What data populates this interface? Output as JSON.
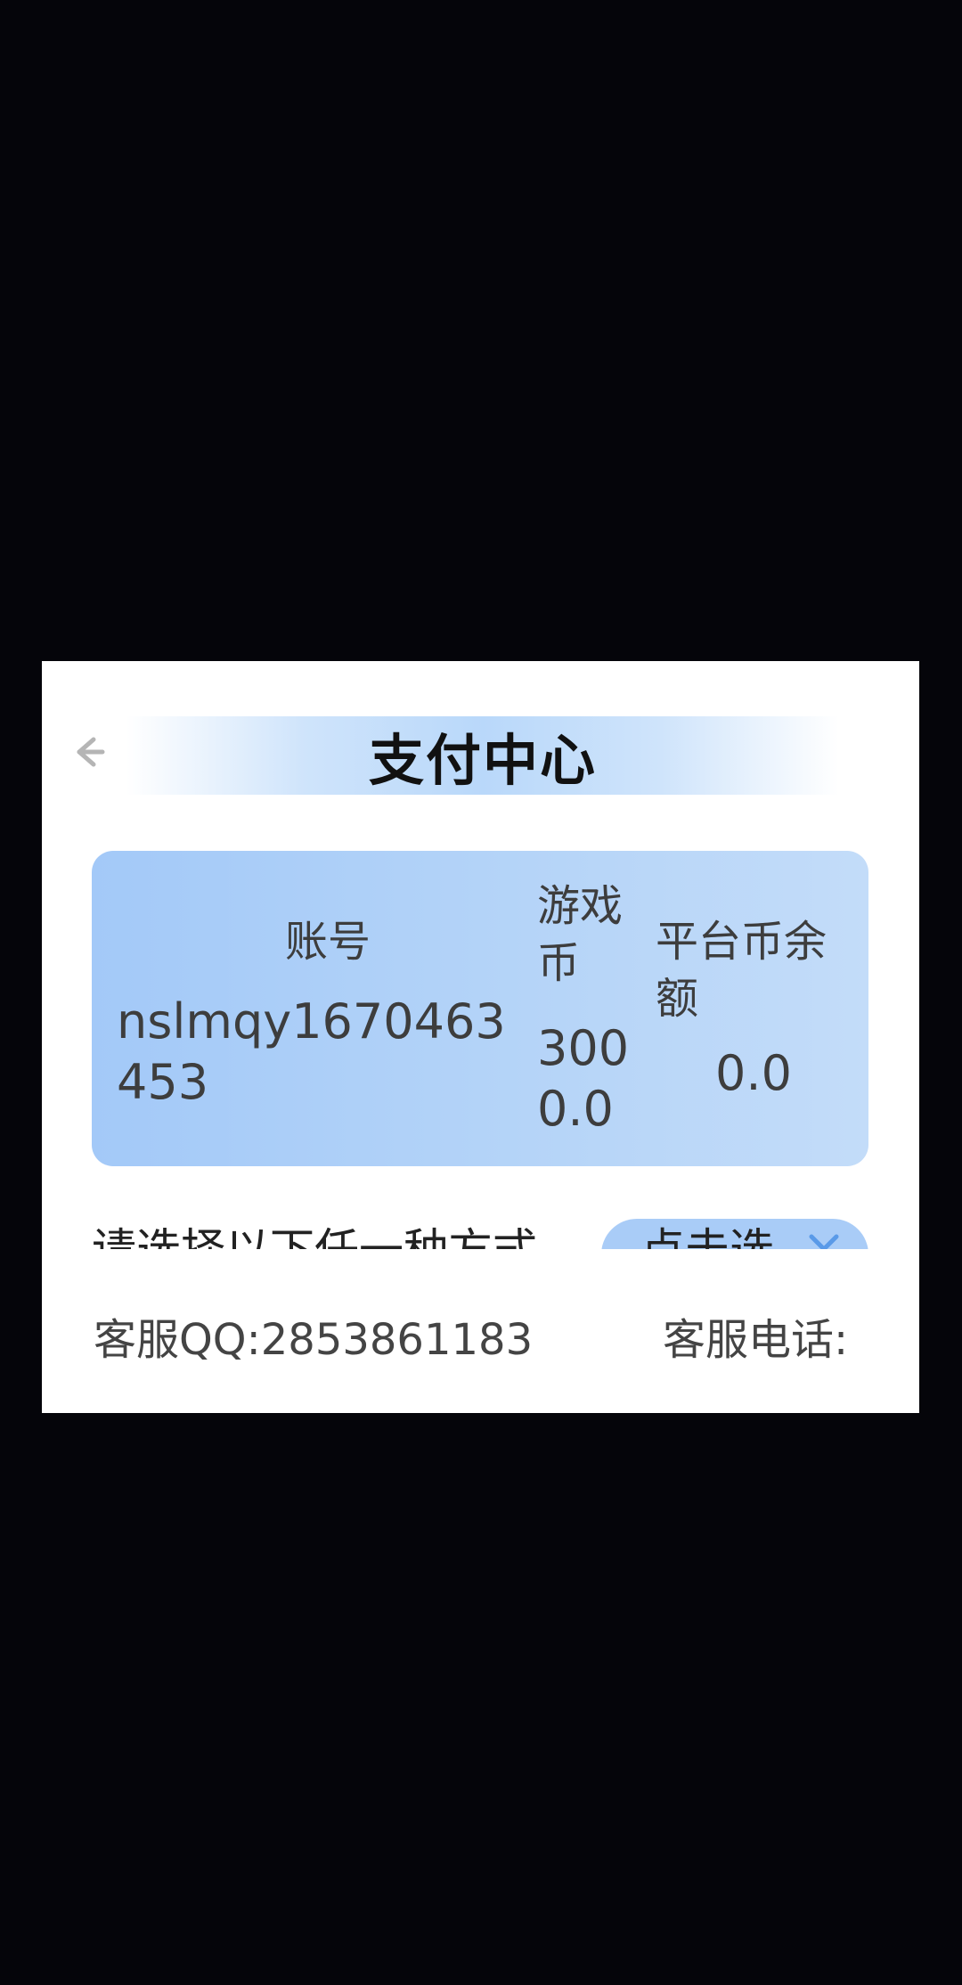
{
  "header": {
    "title": "支付中心",
    "back_icon": "arrow-left-icon"
  },
  "account_card": {
    "account_label": "账号",
    "account_value": "nslmqy1670463453",
    "game_coin_label": "游戏币",
    "game_coin_value": "3000.0",
    "platform_balance_label": "平台币余额",
    "platform_balance_value": "0.0"
  },
  "payment": {
    "prompt": "请选择以下任一种方式",
    "select_label": "点击选",
    "select_icon": "chevron-down-icon"
  },
  "footer": {
    "qq": "客服QQ:2853861183",
    "phone": "客服电话:"
  },
  "colors": {
    "background": "#05050a",
    "card_start": "#a3c9f8",
    "card_end": "#c3dcf9",
    "title_band": "#b9d8fa"
  }
}
